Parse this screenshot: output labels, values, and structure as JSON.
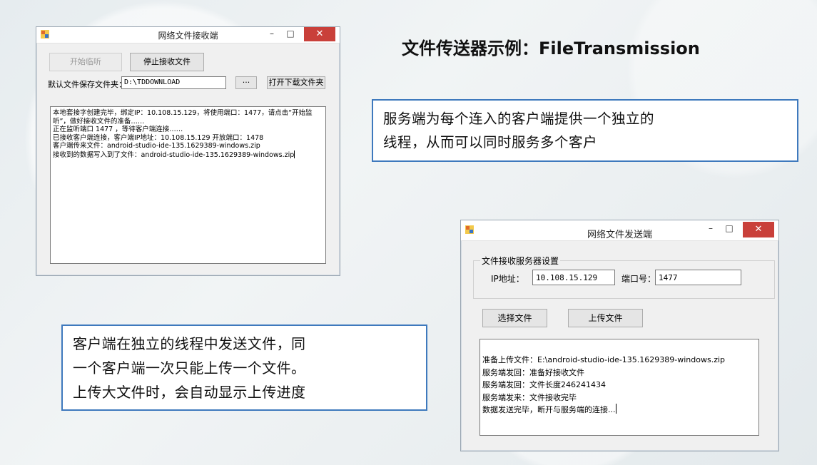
{
  "slide": {
    "title": "文件传送器示例：FileTransmission",
    "callout_server": [
      "服务端为每个连入的客户端提供一个独立的",
      "线程，从而可以同时服务多个客户"
    ],
    "callout_client": [
      "客户端在独立的线程中发送文件，同",
      "一个客户端一次只能上传一个文件。",
      "上传大文件时，会自动显示上传进度"
    ]
  },
  "receiver": {
    "title": "网络文件接收端",
    "start_btn": "开始临听",
    "stop_btn": "停止接收文件",
    "folder_label": "默认文件保存文件夹：",
    "folder_value": "D:\\TDDOWNLOAD",
    "browse_btn": "···",
    "open_btn": "打开下载文件夹",
    "log": [
      "本地套接字创建完毕，绑定IP：10.108.15.129，将使用端口：1477，请点击“开始监听”，做好接收文件的准备……",
      "",
      "正在监听端口 1477 ，等待客户端连接……",
      "已接收客户端连接，客户端IP地址：10.108.15.129 开放端口：1478",
      "客户端传来文件：android-studio-ide-135.1629389-windows.zip",
      "接收到的数据写入到了文件：android-studio-ide-135.1629389-windows.zip"
    ]
  },
  "sender": {
    "title": "网络文件发送端",
    "group_label": "文件接收服务器设置",
    "ip_label": "IP地址：",
    "ip_value": "10.108.15.129",
    "port_label": "端口号：",
    "port_value": "1477",
    "select_btn": "选择文件",
    "upload_btn": "上传文件",
    "log": [
      "准备上传文件：E:\\android-studio-ide-135.1629389-windows.zip",
      "服务端发回：准备好接收文件",
      "服务端发回：文件长度246241434",
      "服务端发来：文件接收完毕",
      "数据发送完毕，断开与服务端的连接..."
    ]
  },
  "window_controls": {
    "minimize": "–",
    "maximize": "□",
    "close": "✕"
  },
  "colors": {
    "callout_border": "#3e79bd",
    "close_button": "#c9403a"
  }
}
